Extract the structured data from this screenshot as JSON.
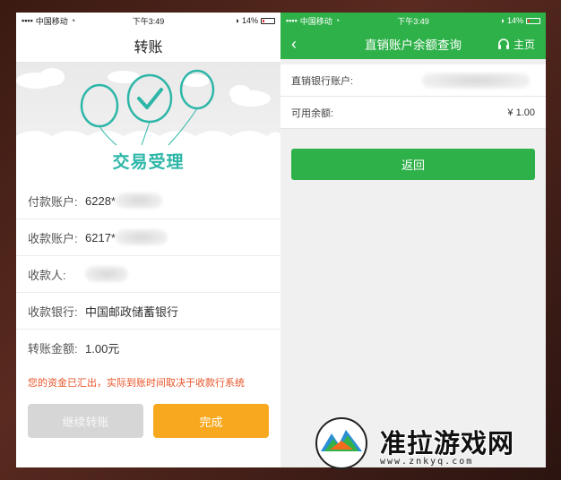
{
  "left": {
    "status": {
      "carrier": "中国移动",
      "time": "下午3:49",
      "battery": "14%"
    },
    "title": "转账",
    "banner_title": "交易受理",
    "rows": [
      {
        "label": "付款账户:",
        "value": "6228*"
      },
      {
        "label": "收款账户:",
        "value": "6217*"
      },
      {
        "label": "收款人:",
        "value": ""
      },
      {
        "label": "收款银行:",
        "value": "中国邮政储蓄银行"
      },
      {
        "label": "转账金额:",
        "value": "1.00元"
      }
    ],
    "notice": "您的资金已汇出，实际到账时间取决于收款行系统",
    "continue_label": "继续转账",
    "done_label": "完成"
  },
  "right": {
    "status": {
      "carrier": "中国移动",
      "time": "下午3:49",
      "battery": "14%"
    },
    "back_symbol": "‹",
    "title": "直销账户余额查询",
    "home_label": "主页",
    "rows": [
      {
        "label": "直销银行账户:",
        "value": ""
      },
      {
        "label": "可用余额:",
        "value": "¥ 1.00"
      }
    ],
    "return_label": "返回"
  },
  "watermark": {
    "text": "准拉游戏网",
    "url": "www.znkyq.com"
  },
  "colors": {
    "green": "#2fb14a",
    "orange": "#f7a81e",
    "teal": "#2db6a8",
    "alert": "#e8552a"
  }
}
